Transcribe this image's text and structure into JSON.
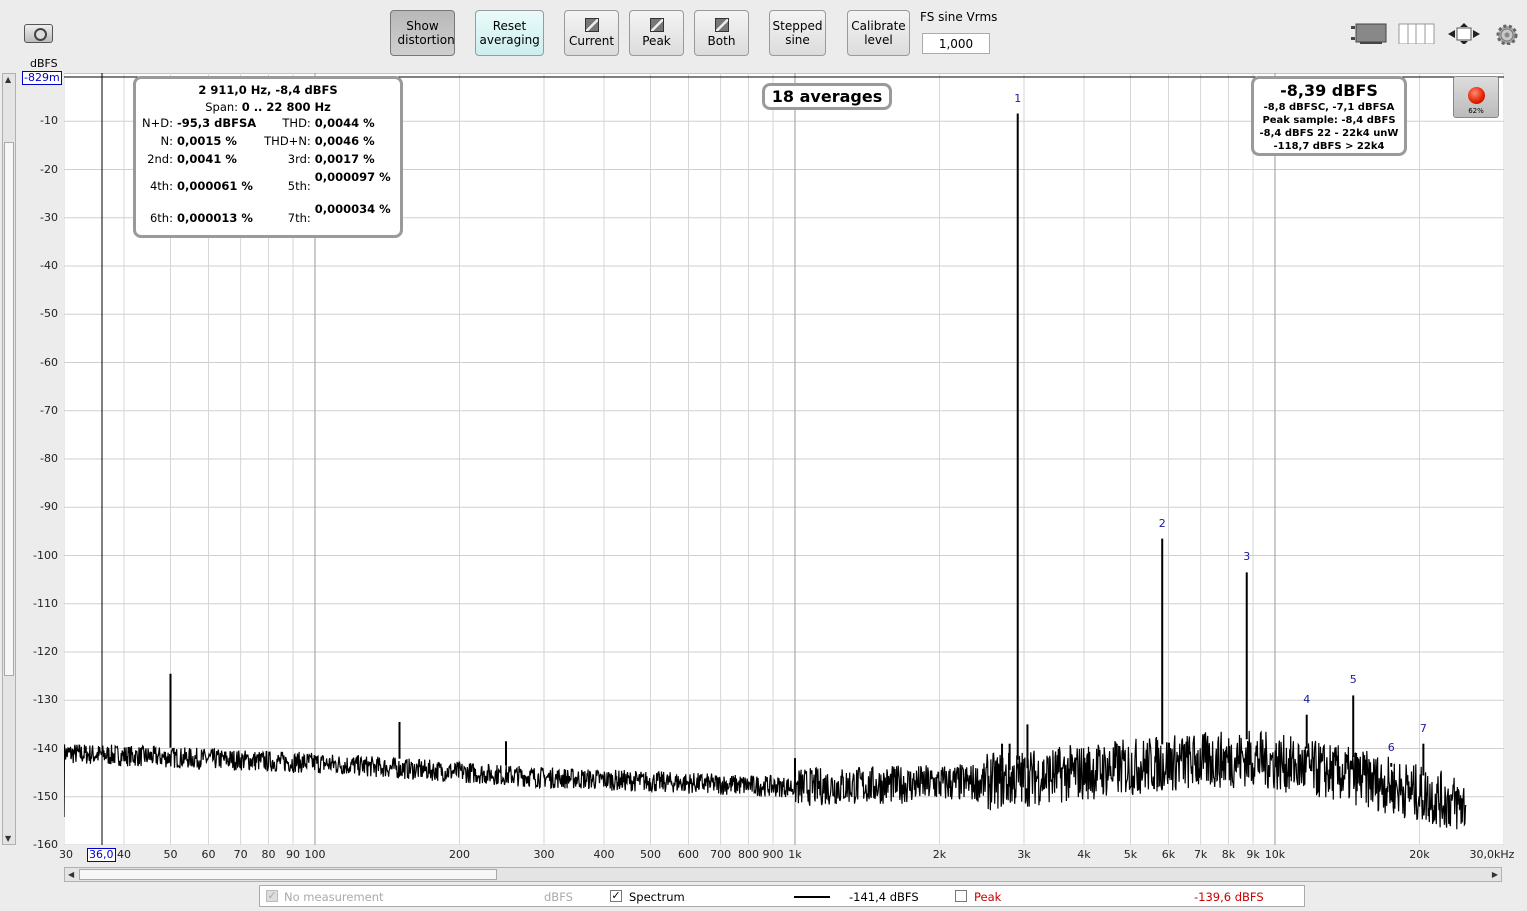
{
  "toolbar": {
    "show_distortion": "Show distortion",
    "reset_averaging": "Reset averaging",
    "current": "Current",
    "peak": "Peak",
    "both": "Both",
    "stepped_sine": "Stepped sine",
    "calibrate_level": "Calibrate level",
    "fs_sine_label": "FS sine Vrms",
    "fs_sine_value": "1,000"
  },
  "plot": {
    "y_unit": "dBFS",
    "y_cursor": "-829m",
    "x_cursor": "36,0",
    "y_ticks": [
      "-10",
      "-20",
      "-30",
      "-40",
      "-50",
      "-60",
      "-70",
      "-80",
      "-90",
      "-100",
      "-110",
      "-120",
      "-130",
      "-140",
      "-150",
      "-160"
    ],
    "x_ticks": [
      "30",
      "40",
      "50",
      "60",
      "70",
      "80",
      "90",
      "100",
      "200",
      "300",
      "400",
      "500",
      "600",
      "700",
      "800",
      "900",
      "1k",
      "2k",
      "3k",
      "4k",
      "5k",
      "6k",
      "7k",
      "8k",
      "9k",
      "10k",
      "20k",
      "30,0kHz"
    ],
    "harmonic_labels": [
      "1",
      "2",
      "3",
      "4",
      "5",
      "6",
      "7"
    ]
  },
  "distortion": {
    "header": "2 911,0 Hz, -8,4 dBFS",
    "span_label": "Span:",
    "span_value": "0 .. 22 800 Hz",
    "nd_label": "N+D:",
    "nd_value": "-95,3 dBFSA",
    "thd_label": "THD:",
    "thd_value": "0,0044 %",
    "n_label": "N:",
    "n_value": "0,0015 %",
    "thdn_label": "THD+N:",
    "thdn_value": "0,0046 %",
    "h2_label": "2nd:",
    "h2_value": "0,0041 %",
    "h3_label": "3rd:",
    "h3_value": "0,0017 %",
    "h4_label": "4th:",
    "h4_value": "0,000061 %",
    "h5_label": "5th:",
    "h5_value": "0,000097 %",
    "h6_label": "6th:",
    "h6_value": "0,000013 %",
    "h7_label": "7th:",
    "h7_value": "0,000034 %"
  },
  "averages": "18 averages",
  "level": {
    "main": "-8,39 dBFS",
    "line1": "-8,8 dBFSC, -7,1 dBFSA",
    "line2": "Peak sample: -8,4 dBFS",
    "line3": "-8,4 dBFS 22 - 22k4 unW",
    "line4": "-118,7 dBFS > 22k4"
  },
  "record": {
    "pct": "62%"
  },
  "legend": {
    "no_measurement": "No measurement",
    "no_measurement_unit": "dBFS",
    "spectrum": "Spectrum",
    "spectrum_value": "-141,4 dBFS",
    "peak": "Peak",
    "peak_value": "-139,6 dBFS"
  },
  "colors": {
    "trace": "#000000",
    "grid": "#c8c8c8",
    "peak_text": "#cc0000",
    "harmonic": "#1a1a9c"
  },
  "chart_data": {
    "type": "line",
    "x_scale": "log",
    "xlim": [
      30,
      30000
    ],
    "ylim": [
      -160,
      0
    ],
    "series": [
      {
        "name": "Spectrum"
      }
    ],
    "peaks": [
      {
        "harmonic": "1",
        "freq": 2911,
        "dbfs": -8.4
      },
      {
        "harmonic": "2",
        "freq": 5822,
        "dbfs": -96.5
      },
      {
        "harmonic": "3",
        "freq": 8733,
        "dbfs": -103.5
      },
      {
        "harmonic": "4",
        "freq": 11644,
        "dbfs": -133
      },
      {
        "harmonic": "5",
        "freq": 14555,
        "dbfs": -129
      },
      {
        "harmonic": "6",
        "freq": 17466,
        "dbfs": -143
      },
      {
        "harmonic": "7",
        "freq": 20377,
        "dbfs": -139
      }
    ],
    "spurs": [
      {
        "freq": 50,
        "dbfs": -124.5
      },
      {
        "freq": 150,
        "dbfs": -134.5
      },
      {
        "freq": 250,
        "dbfs": -138.5
      },
      {
        "freq": 1000,
        "dbfs": -142
      },
      {
        "freq": 2700,
        "dbfs": -139
      },
      {
        "freq": 2800,
        "dbfs": -139
      },
      {
        "freq": 3050,
        "dbfs": -135
      }
    ],
    "noise_floor": [
      {
        "freq": 30,
        "dbfs": -141
      },
      {
        "freq": 100,
        "dbfs": -143
      },
      {
        "freq": 300,
        "dbfs": -146
      },
      {
        "freq": 1000,
        "dbfs": -148
      },
      {
        "freq": 2500,
        "dbfs": -147
      },
      {
        "freq": 6000,
        "dbfs": -143
      },
      {
        "freq": 9000,
        "dbfs": -142
      },
      {
        "freq": 15000,
        "dbfs": -146
      },
      {
        "freq": 25000,
        "dbfs": -152
      }
    ]
  }
}
